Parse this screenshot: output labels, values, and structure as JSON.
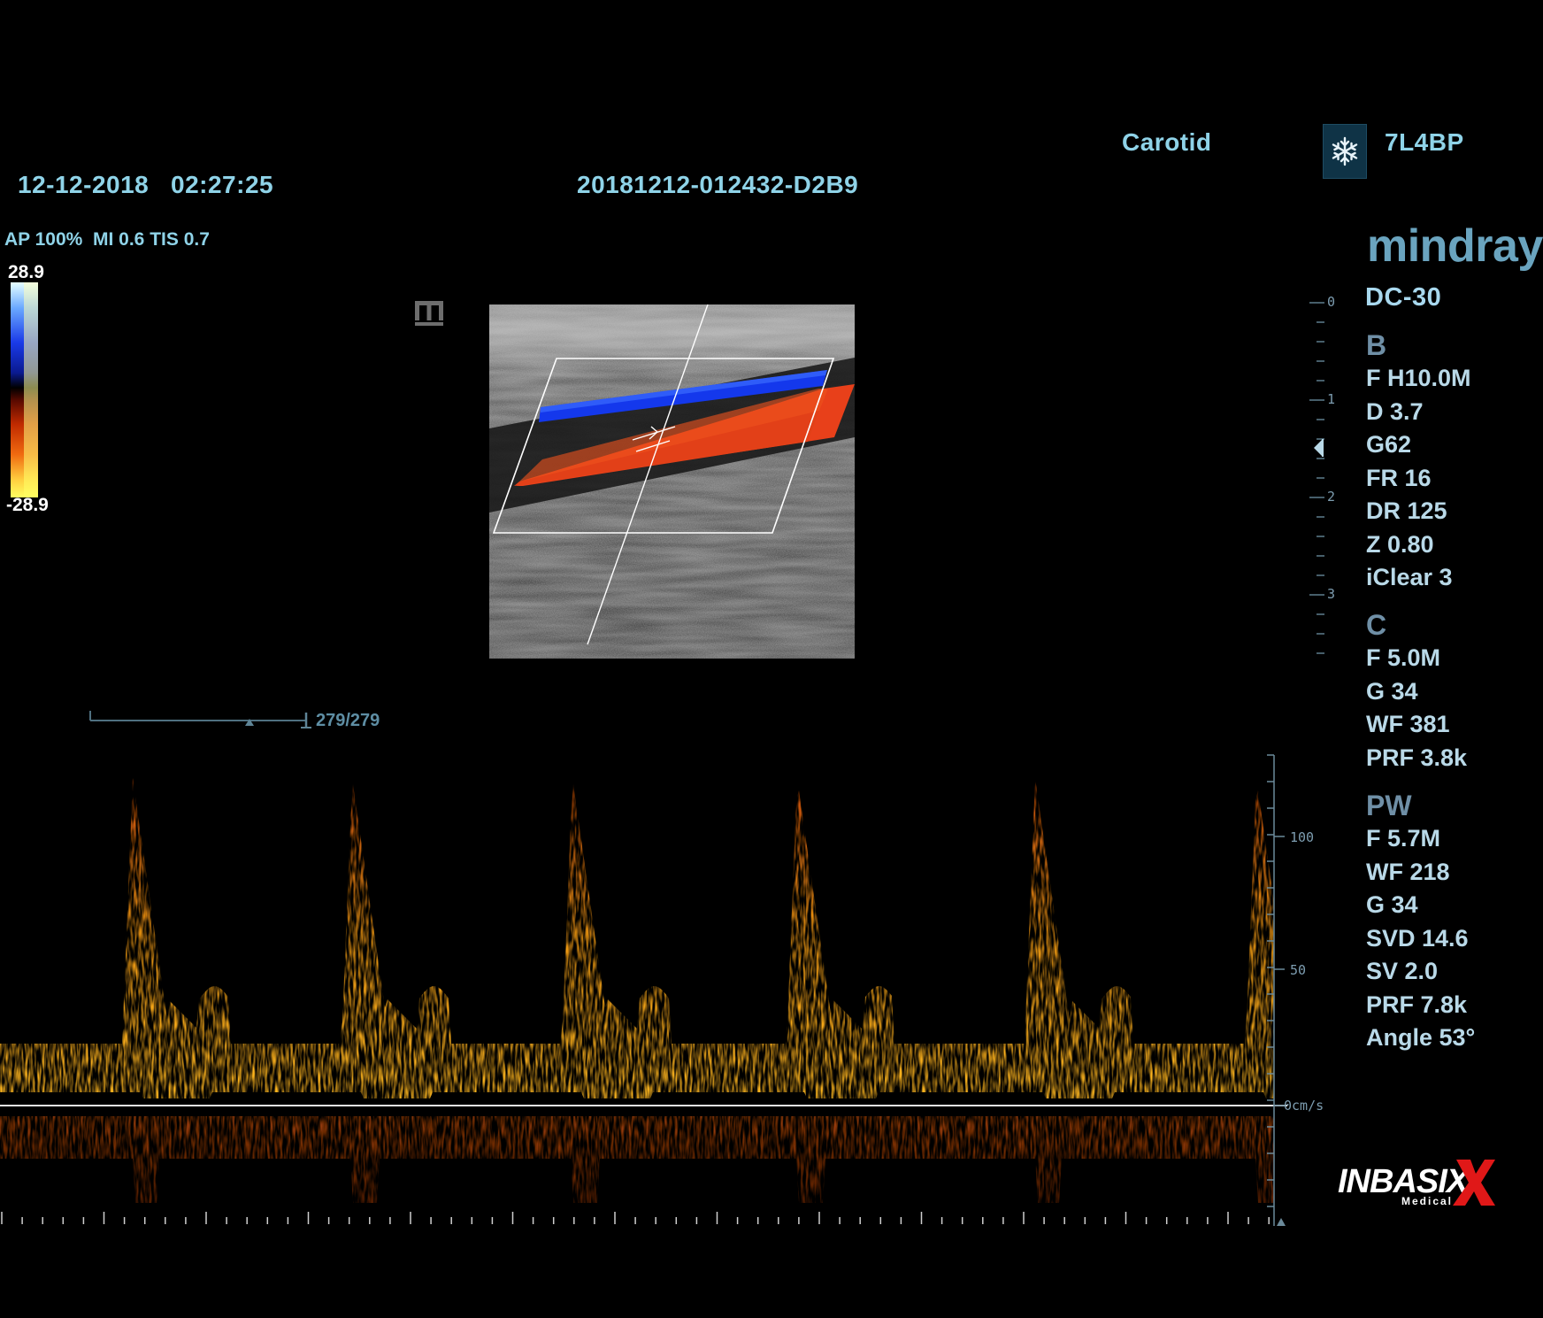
{
  "header": {
    "exam": "Carotid",
    "probe": "7L4BP",
    "date": "12-12-2018",
    "time": "02:27:25",
    "patient_id": "20181212-012432-D2B9"
  },
  "acoustic": {
    "text": "AP 100%  MI 0.6 TIS 0.7"
  },
  "color_scale": {
    "max": "28.9",
    "min": "-28.9"
  },
  "brand": {
    "logo_text": "mindray",
    "model": "DC-30",
    "dealer_logo": "INBASIX",
    "dealer_sub": "Medical"
  },
  "icons": {
    "freeze": "snowflake-icon",
    "m_marker": "m-icon",
    "focus": "focus-marker-icon"
  },
  "depth_scale": {
    "labels": [
      "0",
      "1",
      "2",
      "3"
    ]
  },
  "cine": {
    "counter": "279/279"
  },
  "velocity_scale": {
    "labels": [
      "100",
      "50",
      "0cm/s"
    ]
  },
  "params": {
    "b": {
      "title": "B",
      "items": [
        "F H10.0M",
        "D 3.7",
        "G62",
        "FR 16",
        "DR 125",
        "Z 0.80",
        "iClear 3"
      ]
    },
    "c": {
      "title": "C",
      "items": [
        "F 5.0M",
        "G 34",
        "WF 381",
        "PRF 3.8k"
      ]
    },
    "pw": {
      "title": "PW",
      "items": [
        "F 5.7M",
        "WF 218",
        "G 34",
        "SVD 14.6",
        "SV 2.0",
        "PRF 7.8k",
        "Angle 53°"
      ]
    }
  },
  "colors": {
    "text_cyan": "#8fd3e8",
    "flow_red": "#e8401a",
    "flow_blue": "#1a3ae8",
    "spectrum_orange": "#ff9c14"
  }
}
